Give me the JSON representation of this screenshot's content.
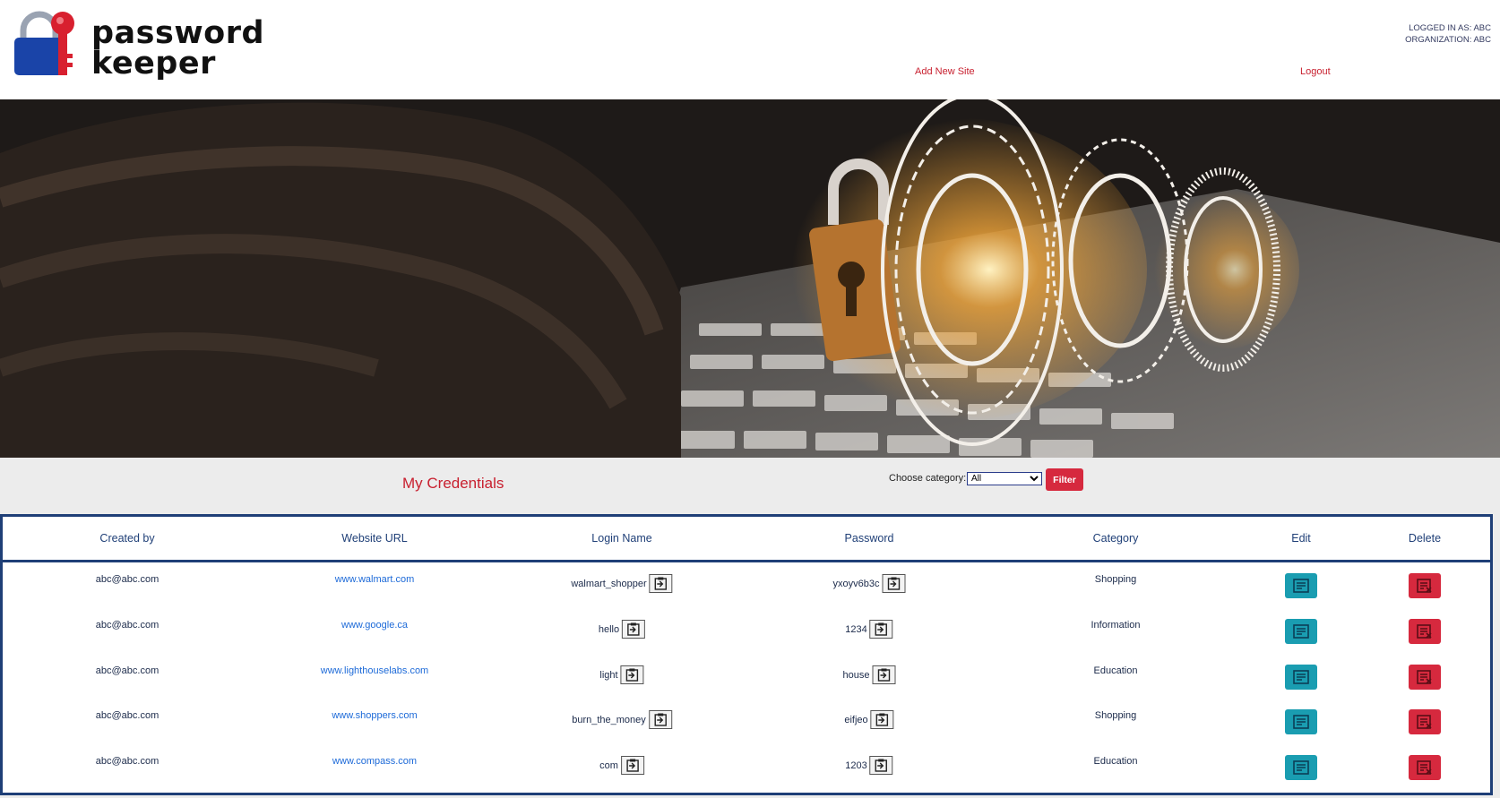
{
  "brand": {
    "line1": "password",
    "line2": "keeper"
  },
  "nav": {
    "add_new_site": "Add New Site",
    "logout": "Logout"
  },
  "session": {
    "logged_in_as": "LOGGED IN AS: abc",
    "organization": "ORGANIZATION: abc"
  },
  "toolbar": {
    "title": "My Credentials",
    "category_label": "Choose category:",
    "category_value": "All",
    "filter_label": "Filter"
  },
  "table": {
    "headers": [
      "Created by",
      "Website URL",
      "Login Name",
      "Password",
      "Category",
      "Edit",
      "Delete"
    ],
    "rows": [
      {
        "created_by": "abc@abc.com",
        "url": "www.walmart.com",
        "login": "walmart_shopper",
        "password": "yxoyv6b3c",
        "category": "Shopping"
      },
      {
        "created_by": "abc@abc.com",
        "url": "www.google.ca",
        "login": "hello",
        "password": "1234",
        "category": "Information"
      },
      {
        "created_by": "abc@abc.com",
        "url": "www.lighthouselabs.com",
        "login": "light",
        "password": "house",
        "category": "Education"
      },
      {
        "created_by": "abc@abc.com",
        "url": "www.shoppers.com",
        "login": "burn_the_money",
        "password": "eifjeo",
        "category": "Shopping"
      },
      {
        "created_by": "abc@abc.com",
        "url": "www.compass.com",
        "login": "com",
        "password": "1203",
        "category": "Education"
      }
    ]
  },
  "icons": {
    "logo": "padlock-key-logo",
    "copy": "clipboard-copy-icon",
    "edit": "edit-document-icon",
    "delete": "delete-document-icon"
  },
  "colors": {
    "accent_red": "#c8202f",
    "table_border": "#1f3f77",
    "edit_button": "#1a9db1",
    "delete_button": "#d6293e"
  }
}
